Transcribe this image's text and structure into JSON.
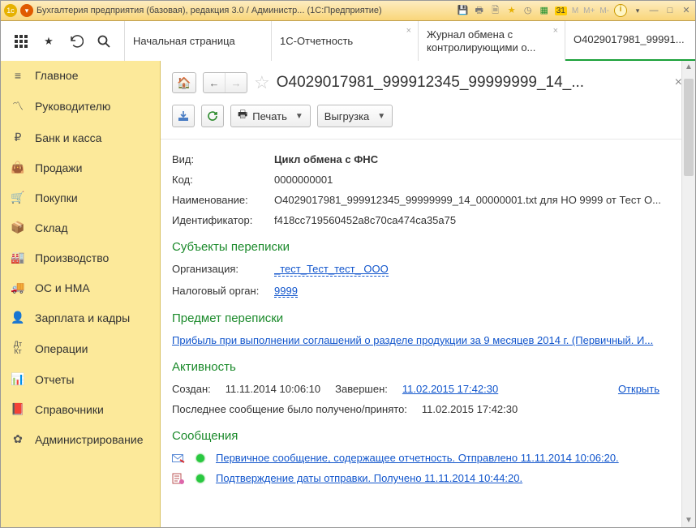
{
  "titlebar": {
    "app_title": "Бухгалтерия предприятия (базовая), редакция 3.0 / Администр...  (1С:Предприятие)",
    "mem_m": "M",
    "mem_mplus": "M+",
    "mem_mminus": "M-"
  },
  "tabs": {
    "start": "Начальная страница",
    "t1": "1С-Отчетность",
    "t2": "Журнал обмена с контролирующими о...",
    "t3": "O4029017981_99991..."
  },
  "sidebar": {
    "i0": "Главное",
    "i1": "Руководителю",
    "i2": "Банк и касса",
    "i3": "Продажи",
    "i4": "Покупки",
    "i5": "Склад",
    "i6": "Производство",
    "i7": "ОС и НМА",
    "i8": "Зарплата и кадры",
    "i9": "Операции",
    "i10": "Отчеты",
    "i11": "Справочники",
    "i12": "Администрирование"
  },
  "doc": {
    "title": "O4029017981_999912345_99999999_14_...",
    "print_label": "Печать",
    "export_label": "Выгрузка",
    "fields": {
      "vid_l": "Вид:",
      "vid_v": "Цикл обмена с ФНС",
      "kod_l": "Код:",
      "kod_v": "0000000001",
      "name_l": "Наименование:",
      "name_v": "O4029017981_999912345_99999999_14_00000001.txt для НО 9999 от Тест О...",
      "id_l": "Идентификатор:",
      "id_v": "f418cc719560452a8c70ca474ca35a75"
    },
    "s1": "Субъекты переписки",
    "org_l": "Организация:",
    "org_v": "_тест_Тест_тест_ ООО",
    "tax_l": "Налоговый орган:",
    "tax_v": "9999",
    "s2": "Предмет переписки",
    "subject": "Прибыль при выполнении соглашений о разделе продукции за 9 месяцев 2014 г. (Первичный. И...",
    "s3": "Активность",
    "created_l": "Создан:",
    "created_v": "11.11.2014 10:06:10",
    "finished_l": "Завершен:",
    "finished_v": "11.02.2015 17:42:30",
    "open_l": "Открыть",
    "lastmsg_l": "Последнее сообщение было получено/принято:",
    "lastmsg_v": "11.02.2015 17:42:30",
    "s4": "Сообщения",
    "msg1": "Первичное сообщение, содержащее отчетность. Отправлено 11.11.2014 10:06:20.",
    "msg2": "Подтверждение даты отправки. Получено 11.11.2014 10:44:20."
  }
}
